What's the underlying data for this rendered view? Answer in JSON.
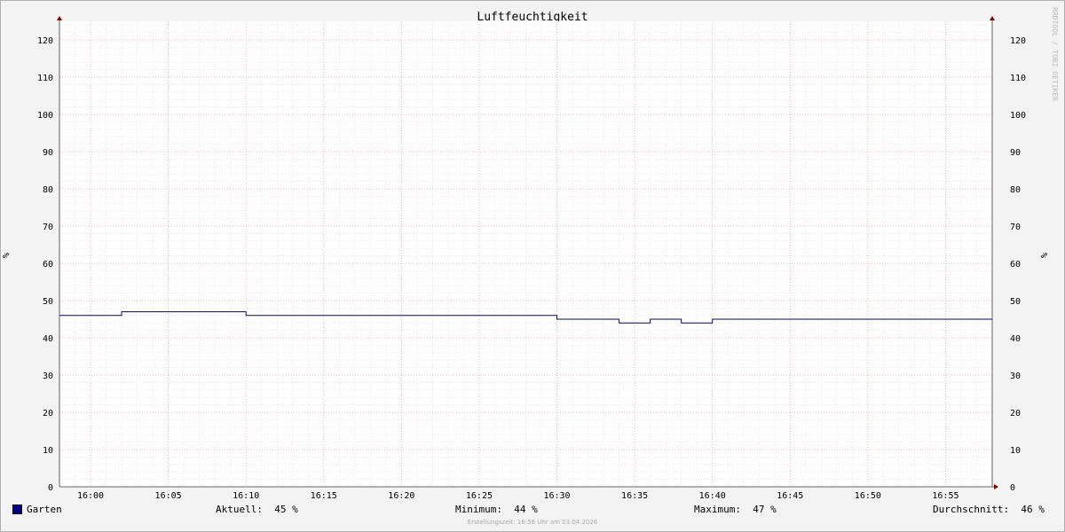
{
  "chart_data": {
    "type": "line",
    "title": "Luftfeuchtigkeit",
    "ylabel": "%",
    "ylim": [
      0,
      125
    ],
    "yticks": [
      0,
      10,
      20,
      30,
      40,
      50,
      60,
      70,
      80,
      90,
      100,
      110,
      120
    ],
    "xticks": [
      "16:00",
      "16:05",
      "16:10",
      "16:15",
      "16:20",
      "16:25",
      "16:30",
      "16:35",
      "16:40",
      "16:45",
      "16:50",
      "16:55"
    ],
    "grid": true,
    "legend_position": "bottom",
    "series": [
      {
        "name": "Garten",
        "color": "#00008b",
        "x": [
          "15:58",
          "16:02",
          "16:10",
          "16:30",
          "16:34",
          "16:36",
          "16:38",
          "16:40",
          "16:58"
        ],
        "y": [
          46,
          47,
          46,
          45,
          44,
          45,
          44,
          45,
          45
        ]
      }
    ]
  },
  "stats": {
    "current_label": "Aktuell:",
    "current_value": "45 %",
    "min_label": "Minimum:",
    "min_value": "44 %",
    "max_label": "Maximum:",
    "max_value": "47 %",
    "avg_label": "Durchschnitt:",
    "avg_value": "46 %"
  },
  "watermark": "RRDTOOL / TOBI OETIKER",
  "footer": "Erstellungszeit: 16:58 Uhr am 03.04.2026"
}
